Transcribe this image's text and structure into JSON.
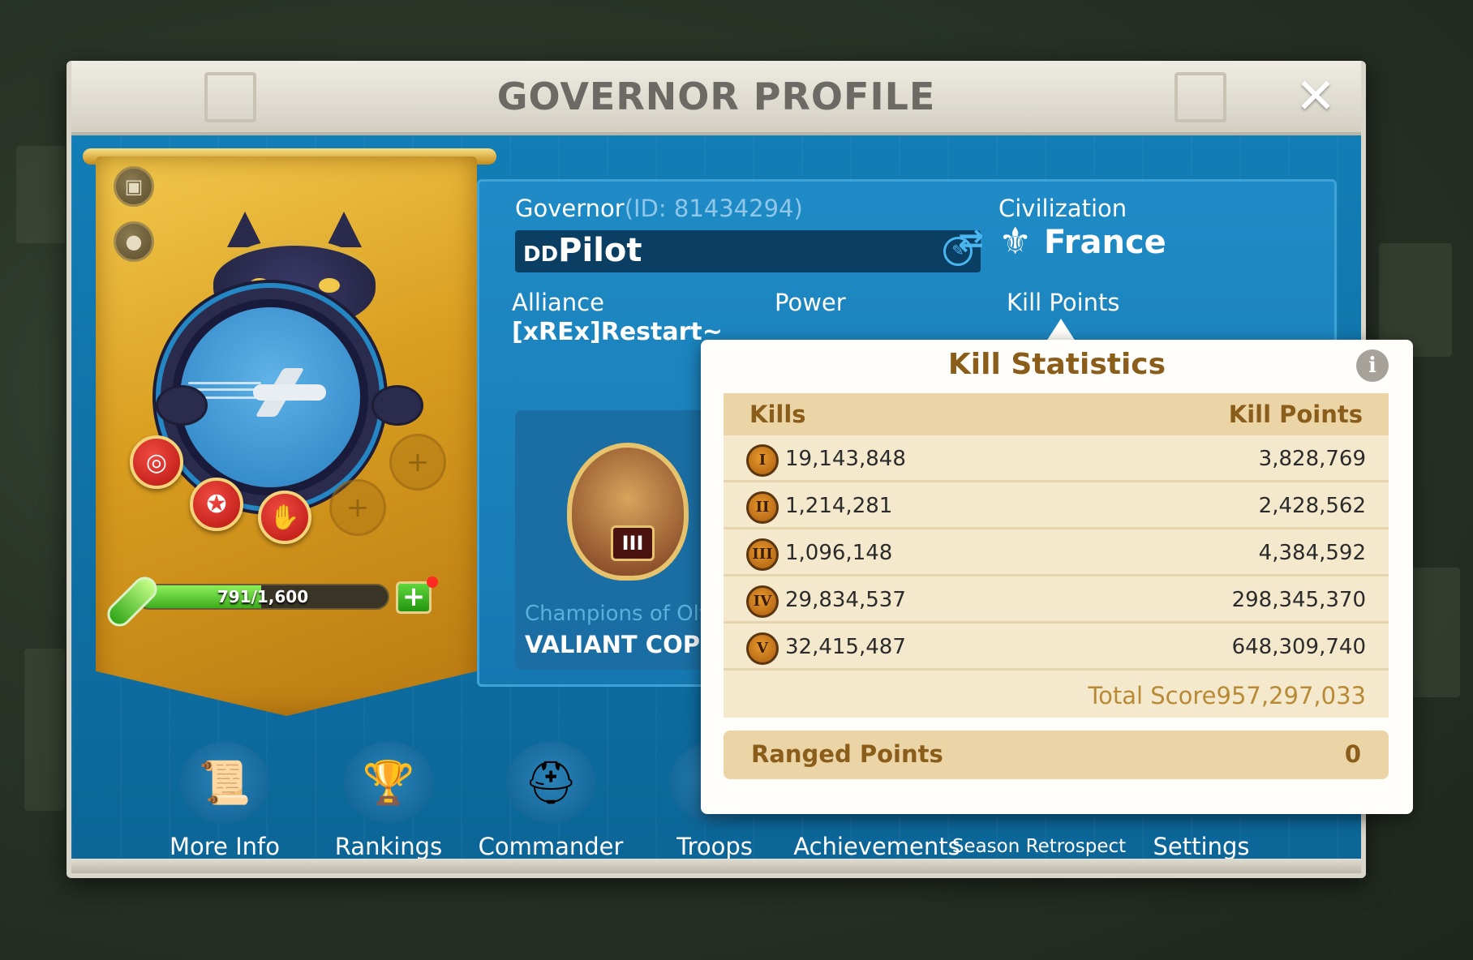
{
  "title": "GOVERNOR PROFILE",
  "governor": {
    "label": "Governor",
    "id_text": "(ID: 81434294)",
    "name_prefix": "DD",
    "name": "Pilot"
  },
  "civilization": {
    "label": "Civilization",
    "name": "France"
  },
  "alliance": {
    "label": "Alliance",
    "name": "[xREx]Restart~"
  },
  "power": {
    "label": "Power"
  },
  "kill_points": {
    "label": "Kill Points"
  },
  "medal": {
    "roman": "III",
    "subtitle": "Champions of Oly",
    "title": "VALIANT COPPE"
  },
  "exp": {
    "text": "791/1,600",
    "current": 791,
    "max": 1600
  },
  "nav": [
    {
      "label": "More Info"
    },
    {
      "label": "Rankings"
    },
    {
      "label": "Commander"
    },
    {
      "label": "Troops"
    },
    {
      "label": "Achievements"
    },
    {
      "label": "Season Retrospect"
    },
    {
      "label": "Settings"
    }
  ],
  "kill_stats": {
    "title": "Kill Statistics",
    "col_kills": "Kills",
    "col_points": "Kill Points",
    "rows": [
      {
        "tier": "I",
        "kills": "19,143,848",
        "points": "3,828,769"
      },
      {
        "tier": "II",
        "kills": "1,214,281",
        "points": "2,428,562"
      },
      {
        "tier": "III",
        "kills": "1,096,148",
        "points": "4,384,592"
      },
      {
        "tier": "IV",
        "kills": "29,834,537",
        "points": "298,345,370"
      },
      {
        "tier": "V",
        "kills": "32,415,487",
        "points": "648,309,740"
      }
    ],
    "total_label": "Total Score",
    "total_value": "957,297,033",
    "ranged_label": "Ranged Points",
    "ranged_value": "0"
  },
  "colors": {
    "panel_blue": "#0f74a8",
    "popup_gold_text": "#8a5d1a",
    "banner_gold": "#d99d1f"
  }
}
